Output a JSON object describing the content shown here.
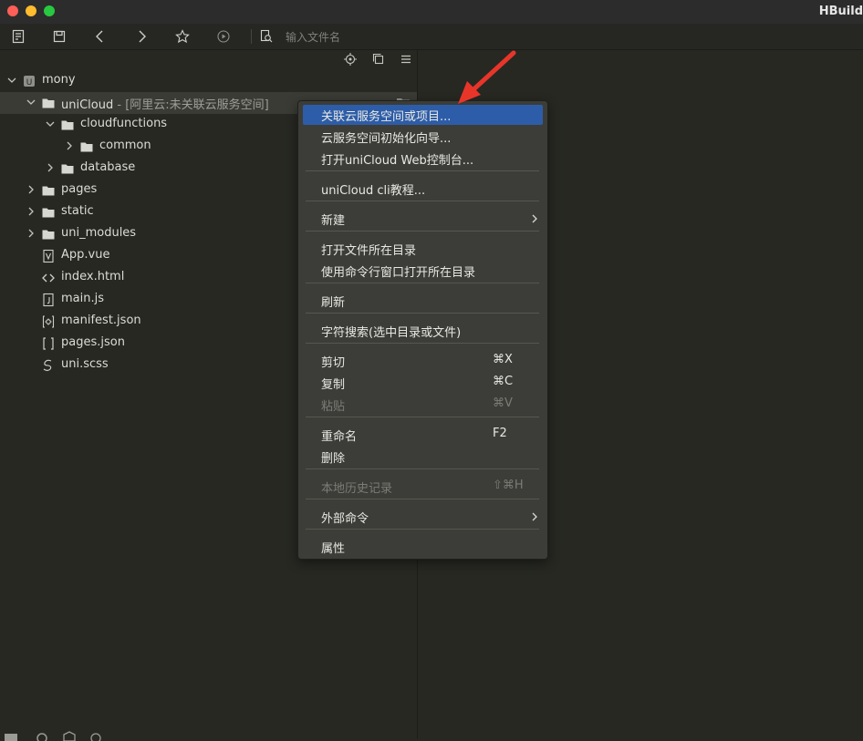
{
  "window": {
    "title": "HBuild"
  },
  "colors": {
    "accent": "#2d5da8",
    "arrow": "#e8352a",
    "close": "#fe5f57",
    "minimize": "#febc2e",
    "maximize": "#28c840"
  },
  "toolbar": {
    "icons": [
      "new-file-icon",
      "save-icon",
      "back-icon",
      "forward-icon",
      "star-icon",
      "run-icon",
      "search-file-icon"
    ],
    "search_placeholder": "输入文件名"
  },
  "sidebar": {
    "tools": [
      "locate-icon",
      "collapse-icon",
      "menu-icon"
    ],
    "tree": [
      {
        "label": "mony",
        "note": "",
        "icon": "project-icon",
        "expanded": true
      },
      {
        "label": "uniCloud",
        "note": " - [阿里云:未关联云服务空间]",
        "icon": "folder-icon",
        "expanded": true,
        "selected": true
      },
      {
        "label": "cloudfunctions",
        "note": "",
        "icon": "folder-icon",
        "expanded": true
      },
      {
        "label": "common",
        "note": "",
        "icon": "folder-icon",
        "expanded": false
      },
      {
        "label": "database",
        "note": "",
        "icon": "folder-icon",
        "expanded": false
      },
      {
        "label": "pages",
        "note": "",
        "icon": "folder-icon",
        "expanded": false
      },
      {
        "label": "static",
        "note": "",
        "icon": "folder-icon",
        "expanded": false
      },
      {
        "label": "uni_modules",
        "note": "",
        "icon": "folder-icon",
        "expanded": false
      },
      {
        "label": "App.vue",
        "note": "",
        "icon": "vue-file-icon"
      },
      {
        "label": "index.html",
        "note": "",
        "icon": "html-file-icon"
      },
      {
        "label": "main.js",
        "note": "",
        "icon": "js-file-icon"
      },
      {
        "label": "manifest.json",
        "note": "",
        "icon": "json-settings-icon"
      },
      {
        "label": "pages.json",
        "note": "",
        "icon": "json-file-icon"
      },
      {
        "label": "uni.scss",
        "note": "",
        "icon": "scss-file-icon"
      }
    ]
  },
  "context_menu": {
    "items": [
      {
        "label": "关联云服务空间或项目...",
        "shortcut": "",
        "highlighted": true
      },
      {
        "label": "云服务空间初始化向导...",
        "shortcut": ""
      },
      {
        "label": "打开uniCloud Web控制台...",
        "shortcut": ""
      },
      {
        "label": "uniCloud cli教程...",
        "shortcut": ""
      },
      {
        "label": "新建",
        "shortcut": "",
        "submenu": true
      },
      {
        "label": "打开文件所在目录",
        "shortcut": ""
      },
      {
        "label": "使用命令行窗口打开所在目录",
        "shortcut": ""
      },
      {
        "label": "刷新",
        "shortcut": ""
      },
      {
        "label": "字符搜索(选中目录或文件)",
        "shortcut": ""
      },
      {
        "label": "剪切",
        "shortcut": "⌘X"
      },
      {
        "label": "复制",
        "shortcut": "⌘C"
      },
      {
        "label": "粘贴",
        "shortcut": "⌘V",
        "disabled": true
      },
      {
        "label": "重命名",
        "shortcut": "F2"
      },
      {
        "label": "删除",
        "shortcut": ""
      },
      {
        "label": "本地历史记录",
        "shortcut": "⇧⌘H",
        "disabled": true
      },
      {
        "label": "外部命令",
        "shortcut": "",
        "submenu": true
      },
      {
        "label": "属性",
        "shortcut": ""
      }
    ]
  }
}
